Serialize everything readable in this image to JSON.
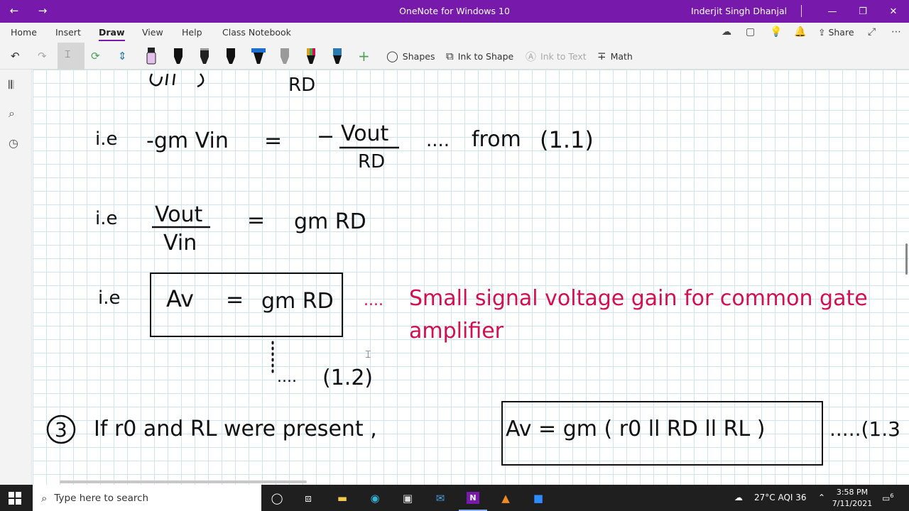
{
  "titlebar": {
    "app_title": "OneNote for Windows 10",
    "user_name": "Inderjit Singh Dhanjal",
    "accent_color": "#7719aa"
  },
  "menu": {
    "tabs": [
      "Home",
      "Insert",
      "Draw",
      "View",
      "Help",
      "Class Notebook"
    ],
    "active_tab": "Draw",
    "share_label": "Share"
  },
  "toolbar": {
    "shapes_label": "Shapes",
    "ink_to_shape_label": "Ink to Shape",
    "ink_to_text_label": "Ink to Text",
    "math_label": "Math",
    "pen_colors": [
      "#e4c0ec",
      "#111111",
      "#222222",
      "#111111",
      "#1a6fd0",
      "#9a9a9a",
      "#d9a020",
      "#2a7ab0"
    ]
  },
  "page": {
    "line0": {
      "rd": "RD"
    },
    "line1": {
      "ie": "i.e",
      "lhs": "-gm Vin",
      "eq": "=",
      "minus": "−",
      "num": "Vout",
      "den": "RD",
      "dots": "....",
      "from": "from",
      "ref": "(1.1)"
    },
    "line2": {
      "ie": "i.e",
      "num": "Vout",
      "den": "Vin",
      "eq": "=",
      "rhs": "gm RD"
    },
    "line3": {
      "ie": "i.e",
      "formula_av": "Av",
      "formula_eq": "=",
      "formula_rhs": "gm RD",
      "dots": "....",
      "note_line1": "Small signal voltage gain for common gate",
      "note_line2": "amplifier",
      "ref_dots": "....",
      "ref": "(1.2)"
    },
    "line4": {
      "num": "3",
      "text": "If  r0  and  RL  were  present ,",
      "formula": "Av = gm ( r0 ll RD ll RL )",
      "ref": ".....(1.3"
    },
    "note_color": "#d40f4f"
  },
  "taskbar": {
    "search_placeholder": "Type here to search",
    "weather": "27°C  AQI 36",
    "time": "3:58 PM",
    "date": "7/11/2021",
    "notification_count": "6"
  }
}
